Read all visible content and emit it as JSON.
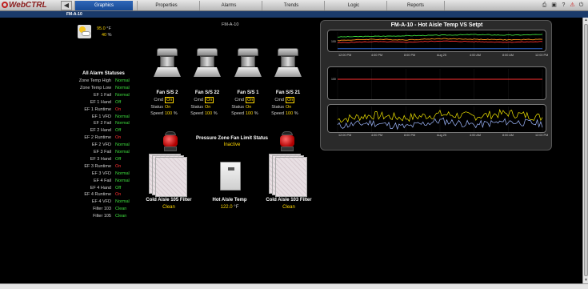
{
  "app": {
    "logo": "WebCTRL"
  },
  "tabs": [
    {
      "label": "Graphics",
      "active": true
    },
    {
      "label": "Properties"
    },
    {
      "label": "Alarms"
    },
    {
      "label": "Trends"
    },
    {
      "label": "Logic"
    },
    {
      "label": "Reports"
    }
  ],
  "breadcrumb": "FM-A-10",
  "graphic_title": "FM-A-10",
  "weather": {
    "temp": "95.0",
    "temp_unit": "°F",
    "humidity": "40",
    "humidity_unit": "%"
  },
  "alarms": {
    "title": "All Alarm Statuses",
    "rows": [
      {
        "label": "Zone Temp High",
        "value": "Normal",
        "color": "#3ddc3d"
      },
      {
        "label": "Zone Temp Low",
        "value": "Normal",
        "color": "#3ddc3d"
      },
      {
        "label": "EF 1 Fail",
        "value": "Normal",
        "color": "#3ddc3d"
      },
      {
        "label": "EF 1 Hand",
        "value": "Off",
        "color": "#3ddc3d"
      },
      {
        "label": "EF 1 Runtime",
        "value": "On",
        "color": "#ff3030"
      },
      {
        "label": "EF 1 VFD",
        "value": "Normal",
        "color": "#3ddc3d"
      },
      {
        "label": "EF 2 Fail",
        "value": "Normal",
        "color": "#3ddc3d"
      },
      {
        "label": "EF 2 Hand",
        "value": "Off",
        "color": "#3ddc3d"
      },
      {
        "label": "EF 2 Runtime",
        "value": "On",
        "color": "#ff3030"
      },
      {
        "label": "EF 2 VFD",
        "value": "Normal",
        "color": "#3ddc3d"
      },
      {
        "label": "EF 3 Fail",
        "value": "Normal",
        "color": "#3ddc3d"
      },
      {
        "label": "EF 3 Hand",
        "value": "Off",
        "color": "#3ddc3d"
      },
      {
        "label": "EF 3 Runtime",
        "value": "On",
        "color": "#ff3030"
      },
      {
        "label": "EF 3 VFD",
        "value": "Normal",
        "color": "#3ddc3d"
      },
      {
        "label": "EF 4 Fail",
        "value": "Normal",
        "color": "#3ddc3d"
      },
      {
        "label": "EF 4 Hand",
        "value": "Off",
        "color": "#3ddc3d"
      },
      {
        "label": "EF 4 Runtime",
        "value": "On",
        "color": "#ff3030"
      },
      {
        "label": "EF 4 VFD",
        "value": "Normal",
        "color": "#3ddc3d"
      },
      {
        "label": "Filter 103",
        "value": "Clean",
        "color": "#3ddc3d"
      },
      {
        "label": "Filter 105",
        "value": "Clean",
        "color": "#3ddc3d"
      }
    ]
  },
  "fans": [
    {
      "title": "Fan S/S 2",
      "cmd": "On",
      "status": "On",
      "speed": "100",
      "unit": "%"
    },
    {
      "title": "Fan S/S 22",
      "cmd": "On",
      "status": "On",
      "speed": "100",
      "unit": "%"
    },
    {
      "title": "Fan S/S 1",
      "cmd": "On",
      "status": "On",
      "speed": "100",
      "unit": "%"
    },
    {
      "title": "Fan S/S 21",
      "cmd": "On",
      "status": "On",
      "speed": "100",
      "unit": "%"
    }
  ],
  "fan_labels": {
    "cmd": "Cmd",
    "status": "Status",
    "speed": "Speed"
  },
  "pressure": {
    "title": "Pressure Zone Fan Limit Status",
    "value": "Inactive"
  },
  "filters": {
    "left": {
      "title": "Cold Aisle 105 Filter",
      "value": "Clean"
    },
    "right": {
      "title": "Cold Aisle 103 Filter",
      "value": "Clean"
    }
  },
  "hot_aisle": {
    "title": "Hot Aisle Temp",
    "value": "122.0",
    "unit": "°F"
  },
  "trend": {
    "title": "FM-A-10 - Hot Aisle Temp VS Setpt",
    "x_labels": [
      "12:00 PM",
      "4:00 PM",
      "8:00 PM",
      "Aug 25",
      "4:00 AM",
      "8:00 AM",
      "12:00 PM"
    ],
    "colors": {
      "green": "#3ddc3d",
      "red": "#ff3030",
      "orange": "#ff9a1a",
      "blue": "#3a7bff",
      "yellow": "#f2e600",
      "lightblue": "#9fb8ff"
    },
    "y_tick_1": "100",
    "y_tick_2": "100"
  },
  "chart_data": [
    {
      "type": "line",
      "x": [
        "12:00 PM",
        "4:00 PM",
        "8:00 PM",
        "Aug 25",
        "4:00 AM",
        "8:00 AM",
        "12:00 PM"
      ],
      "series": [
        {
          "values": [
            118,
            119,
            120,
            121,
            122,
            121,
            122
          ]
        },
        {
          "values": [
            112,
            114,
            113,
            115,
            114,
            113,
            114
          ]
        },
        {
          "values": [
            108,
            110,
            109,
            111,
            110,
            109,
            110
          ]
        },
        {
          "values": [
            98,
            98,
            98,
            98,
            98,
            98,
            98
          ]
        }
      ]
    },
    {
      "type": "line",
      "x": [
        "12:00 PM",
        "4:00 PM",
        "8:00 PM",
        "Aug 25",
        "4:00 AM",
        "8:00 AM",
        "12:00 PM"
      ],
      "series": [
        {
          "values": [
            100,
            100,
            100,
            100,
            100,
            100,
            100
          ]
        }
      ]
    },
    {
      "type": "line",
      "x": [
        "12:00 PM",
        "4:00 PM",
        "8:00 PM",
        "Aug 25",
        "4:00 AM",
        "8:00 AM",
        "12:00 PM"
      ],
      "series": [
        {
          "values": [
            72,
            80,
            75,
            82,
            78,
            84,
            76
          ]
        },
        {
          "values": [
            60,
            66,
            58,
            70,
            62,
            68,
            64
          ]
        }
      ]
    }
  ]
}
